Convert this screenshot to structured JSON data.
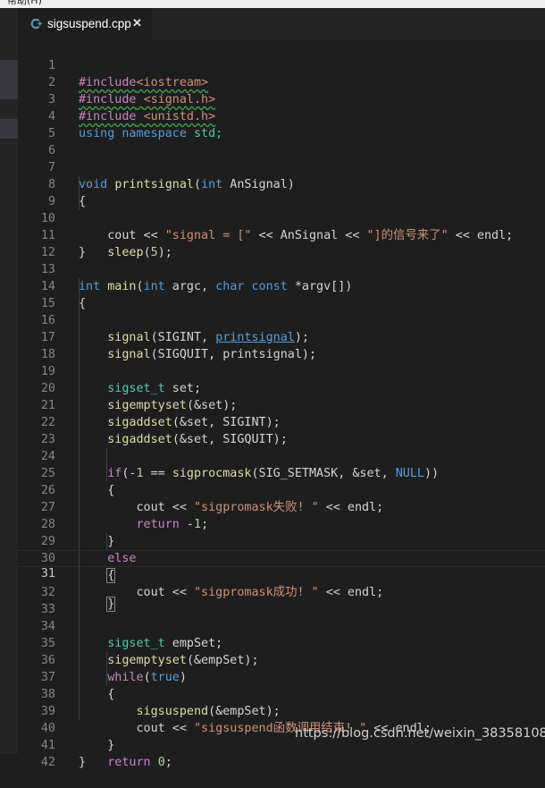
{
  "menubar": {
    "partial_text": "帮助(H)"
  },
  "tab": {
    "filename": "sigsuspend.cpp",
    "close_glyph": "✕",
    "icon": "cpp-file-icon"
  },
  "colors": {
    "background": "#1e1e1e",
    "keyword": "#569cd6",
    "control": "#c586c0",
    "function": "#dcdcaa",
    "string": "#ce9178",
    "number": "#b5cea8",
    "type": "#4ec9b0"
  },
  "editor": {
    "current_line": 31,
    "lines": [
      {
        "n": "1"
      },
      {
        "n": "2"
      },
      {
        "n": "3"
      },
      {
        "n": "4"
      },
      {
        "n": "5"
      },
      {
        "n": "6"
      },
      {
        "n": "7"
      },
      {
        "n": "8"
      },
      {
        "n": "9"
      },
      {
        "n": "10"
      },
      {
        "n": "11"
      },
      {
        "n": "12"
      },
      {
        "n": "13"
      },
      {
        "n": "14"
      },
      {
        "n": "15"
      },
      {
        "n": "16"
      },
      {
        "n": "17"
      },
      {
        "n": "18"
      },
      {
        "n": "19"
      },
      {
        "n": "20"
      },
      {
        "n": "21"
      },
      {
        "n": "22"
      },
      {
        "n": "23"
      },
      {
        "n": "24"
      },
      {
        "n": "25"
      },
      {
        "n": "26"
      },
      {
        "n": "27"
      },
      {
        "n": "28"
      },
      {
        "n": "29"
      },
      {
        "n": "30"
      },
      {
        "n": "31"
      },
      {
        "n": "32"
      },
      {
        "n": "33"
      },
      {
        "n": "34"
      },
      {
        "n": "35"
      },
      {
        "n": "36"
      },
      {
        "n": "37"
      },
      {
        "n": "38"
      },
      {
        "n": "39"
      },
      {
        "n": "40"
      },
      {
        "n": "41"
      },
      {
        "n": "42"
      }
    ],
    "tokens": {
      "l1a": "#include",
      "l1b": "<iostream>",
      "l2a": "#include",
      "l2b": "<signal.h>",
      "l3a": "#include",
      "l3b": "<unistd.h>",
      "l4a": "using",
      "l4b": "namespace",
      "l4c": "std;",
      "l7a": "void",
      "l7b": "printsignal",
      "l7c": "(",
      "l7d": "int",
      "l7e": " AnSignal)",
      "l8": "{",
      "l9a": "cout << ",
      "l9b": "\"signal = [\"",
      "l9c": " << AnSignal << ",
      "l9d": "\"]的信号来了\"",
      "l9e": " << endl;",
      "l10a": "sleep",
      "l10b": "(",
      "l10c": "5",
      "l10d": ");",
      "l11": "}",
      "l13a": "int",
      "l13b": "main",
      "l13c": "(",
      "l13d": "int",
      "l13e": " argc, ",
      "l13f": "char",
      "l13g": "const",
      "l13h": " *argv[])",
      "l14": "{",
      "l15a": "signal",
      "l15b": "(SIGINT, ",
      "l15c": "printsignal",
      "l15d": ");",
      "l16a": "signal",
      "l16b": "(SIGQUIT, printsignal);",
      "l18a": "sigset_t",
      "l18b": " set;",
      "l19a": "sigemptyset",
      "l19b": "(&set);",
      "l20a": "sigaddset",
      "l20b": "(&set, SIGINT);",
      "l21a": "sigaddset",
      "l21b": "(&set, SIGQUIT);",
      "l23a": "if",
      "l23b": "(-",
      "l23c": "1",
      "l23d": " == ",
      "l23e": "sigprocmask",
      "l23f": "(SIG_SETMASK, &set, ",
      "l23g": "NULL",
      "l23h": "))",
      "l24": "{",
      "l25a": "cout << ",
      "l25b": "\"sigpromask失败! \"",
      "l25c": " << endl;",
      "l26a": "return",
      "l26b": " -",
      "l26c": "1",
      "l26d": ";",
      "l27": "}",
      "l28": "else",
      "l29": "{",
      "l30a": "cout << ",
      "l30b": "\"sigpromask成功! \"",
      "l30c": " << endl;",
      "l31": "}",
      "l33a": "sigset_t",
      "l33b": " empSet;",
      "l34a": "sigemptyset",
      "l34b": "(&empSet);",
      "l35a": "while",
      "l35b": "(",
      "l35c": "true",
      "l35d": ")",
      "l36": "{",
      "l37a": "sigsuspend",
      "l37b": "(&empSet);",
      "l38a": "cout << ",
      "l38b": "\"sigsuspend函数调用结束! \"",
      "l38c": " << endl;",
      "l39": "}",
      "l40a": "return",
      "l40b": "0",
      "l40c": ";",
      "l41": "}"
    }
  },
  "watermark": "https://blog.csdn.net/weixin_38358108"
}
